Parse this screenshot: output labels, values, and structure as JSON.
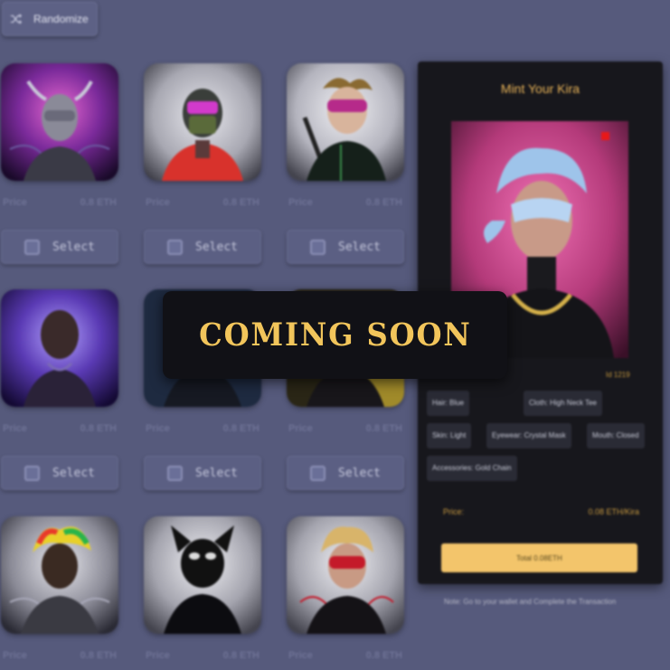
{
  "toolbar": {
    "randomize_label": "Randomize",
    "randomize_icon": "shuffle-icon"
  },
  "grid": {
    "select_label": "Select",
    "cards": [
      {
        "price_label": "Price",
        "price": "0.8 ETH",
        "portrait": "fairy-magenta"
      },
      {
        "price_label": "Price",
        "price": "0.8 ETH",
        "portrait": "robot-red"
      },
      {
        "price_label": "Price",
        "price": "0.8 ETH",
        "portrait": "visor-green"
      },
      {
        "price_label": "Price",
        "price": "0.8 ETH",
        "portrait": "bald-purple"
      },
      {
        "price_label": "Price",
        "price": "0.8 ETH",
        "portrait": "blue-dark"
      },
      {
        "price_label": "Price",
        "price": "0.8 ETH",
        "portrait": "yellow-dark"
      },
      {
        "price_label": "Price",
        "price": "0.8 ETH",
        "portrait": "rainbow-hair"
      },
      {
        "price_label": "Price",
        "price": "0.8 ETH",
        "portrait": "cat-mask"
      },
      {
        "price_label": "Price",
        "price": "0.8 ETH",
        "portrait": "blonde-red-mask"
      }
    ]
  },
  "mint": {
    "title": "Mint Your Kira",
    "id": "Id 1219",
    "traits": [
      "Hair: Blue",
      "Cloth: High Neck Tee",
      "Skin: Light",
      "Eyewear: Crystal Mask",
      "Mouth: Closed",
      "Accessories: Gold Chain"
    ],
    "price_label": "Price:",
    "price_value": "0.08 ETH/Kira",
    "total_label": "Total 0.08ETH",
    "note": "Note: Go to your wallet and Complete the Transaction"
  },
  "overlay": {
    "text": "COMING SOON"
  },
  "colors": {
    "background": "#565a7c",
    "panel": "#17171c",
    "accent": "#f3c56b",
    "gold_text": "#e9b458"
  }
}
